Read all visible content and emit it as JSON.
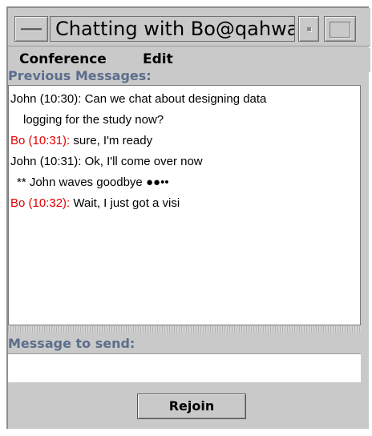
{
  "window": {
    "title": "Chatting with Bo@qahwaji"
  },
  "menubar": {
    "items": [
      {
        "label": "Conference"
      },
      {
        "label": "Edit"
      }
    ]
  },
  "previous_messages": {
    "label": "Previous Messages:",
    "lines": [
      {
        "sender": "John (10:30):",
        "text": "Can we chat about designing data",
        "color": "#000000"
      },
      {
        "continuation": "logging for the study now?"
      },
      {
        "sender": "Bo (10:31):",
        "text": "sure, I'm ready",
        "color": "#e00000"
      },
      {
        "sender": "John (10:31):",
        "text": "Ok, I'll come over now",
        "color": "#000000"
      },
      {
        "action": "** John waves goodbye ●●••"
      },
      {
        "sender": "Bo (10:32):",
        "text": "Wait, I just got a visi",
        "color": "#e00000"
      }
    ]
  },
  "send": {
    "label": "Message to send:",
    "value": ""
  },
  "rejoin_button": {
    "label": "Rejoin"
  }
}
